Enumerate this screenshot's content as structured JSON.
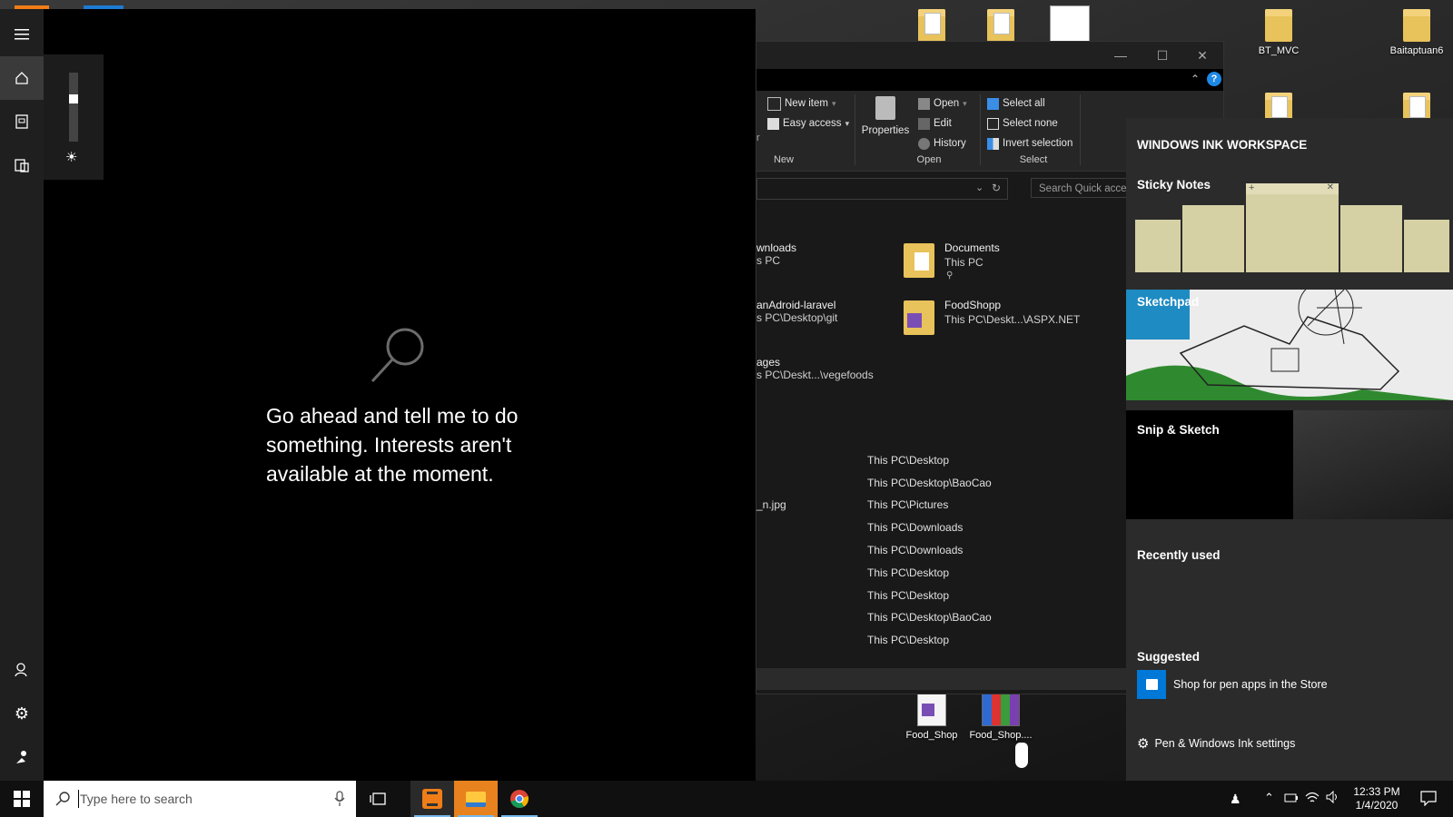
{
  "desktop": {
    "icons": [
      {
        "label": "BT_MVC"
      },
      {
        "label": "Baitaptuan6"
      },
      {
        "label": "Food_Shop"
      },
      {
        "label": "Food_Shop...."
      }
    ]
  },
  "explorer": {
    "ribbon": {
      "new_group": {
        "label": "New",
        "new_item": "New item",
        "easy_access": "Easy access"
      },
      "properties": "Properties",
      "open_group": {
        "label": "Open",
        "open": "Open",
        "edit": "Edit",
        "history": "History"
      },
      "select_group": {
        "label": "Select",
        "select_all": "Select all",
        "select_none": "Select none",
        "invert": "Invert selection"
      },
      "partial_left": "r"
    },
    "search_placeholder": "Search Quick acce",
    "quick_access": [
      {
        "name": "wnloads",
        "path": "s PC"
      },
      {
        "name": "Documents",
        "path": "This PC"
      },
      {
        "name": "anAdroid-laravel",
        "path": "s PC\\Desktop\\git"
      },
      {
        "name": "FoodShopp",
        "path": "This PC\\Deskt...\\ASPX.NET"
      },
      {
        "name": "ages",
        "path": "s PC\\Deskt...\\vegefoods"
      }
    ],
    "recent_partial_name": "_n.jpg",
    "recent_paths": [
      "This PC\\Desktop",
      "This PC\\Desktop\\BaoCao",
      "This PC\\Pictures",
      "This PC\\Downloads",
      "This PC\\Downloads",
      "This PC\\Desktop",
      "This PC\\Desktop",
      "This PC\\Desktop\\BaoCao",
      "This PC\\Desktop"
    ]
  },
  "cortana": {
    "message": "Go ahead and tell me to do something. Interests aren't available at the moment."
  },
  "ink": {
    "title": "WINDOWS INK WORKSPACE",
    "sticky_notes": "Sticky Notes",
    "sketchpad": "Sketchpad",
    "snip_sketch": "Snip & Sketch",
    "recently_used": "Recently used",
    "suggested": "Suggested",
    "store_link": "Shop for pen apps in the Store",
    "settings_link": "Pen & Windows Ink settings"
  },
  "taskbar": {
    "search_placeholder": "Type here to search",
    "time": "12:33 PM",
    "date": "1/4/2020"
  },
  "colors": {
    "accent": "#0078d7",
    "sticky": "#d6d1a5",
    "sublime": "#f07d18",
    "explorer": "#ffc83d"
  }
}
